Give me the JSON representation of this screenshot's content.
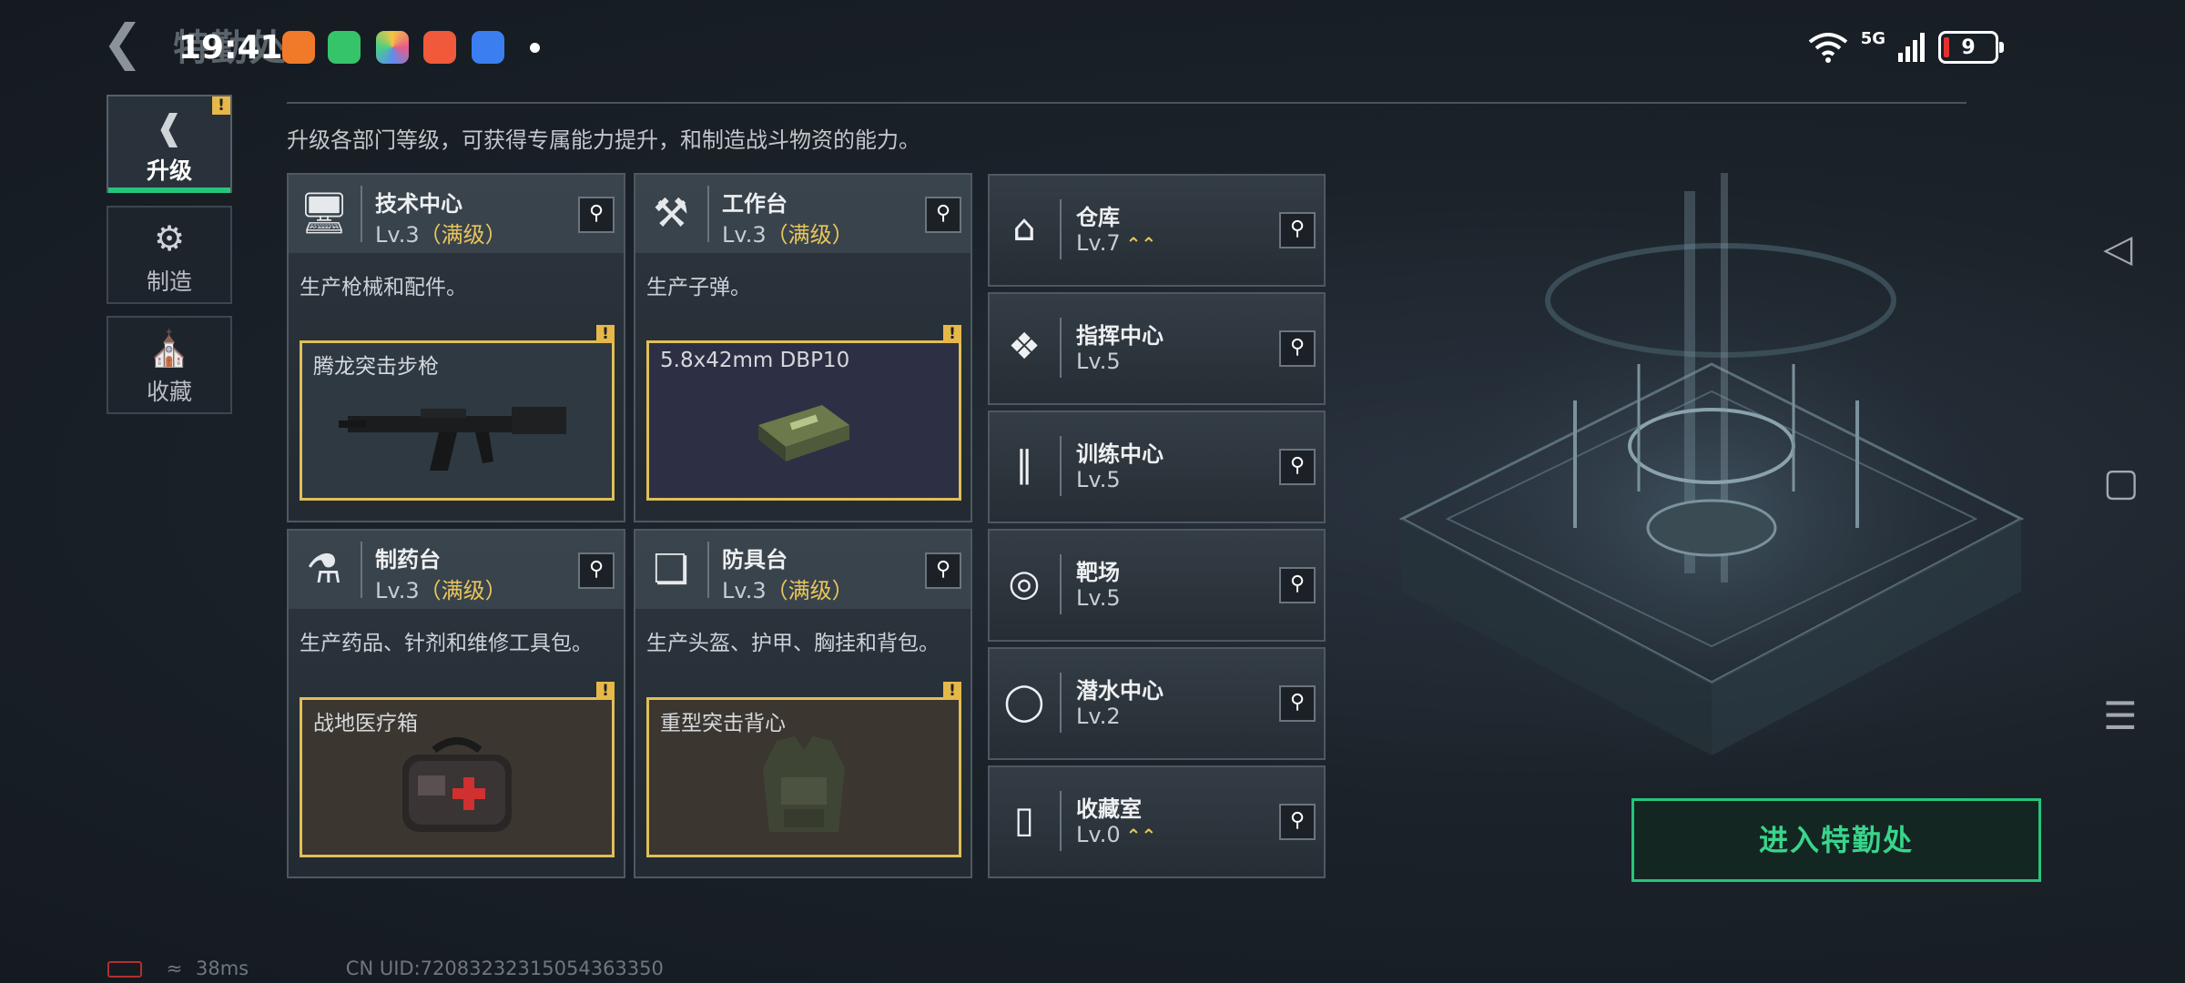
{
  "status_bar": {
    "time": "19:41",
    "ghost_title": "特勤处",
    "network": "5G",
    "battery": "9"
  },
  "side_tabs": [
    {
      "label": "升级",
      "icon": "upgrade-icon"
    },
    {
      "label": "制造",
      "icon": "gears-icon"
    },
    {
      "label": "收藏",
      "icon": "trophy-icon"
    }
  ],
  "intro": "升级各部门等级，可获得专属能力提升，和制造战斗物资的能力。",
  "cards": [
    {
      "name": "技术中心",
      "lv": "Lv.3",
      "max": "（满级）",
      "desc": "生产枪械和配件。",
      "item": "腾龙突击步枪"
    },
    {
      "name": "工作台",
      "lv": "Lv.3",
      "max": "（满级）",
      "desc": "生产子弹。",
      "item": "5.8x42mm DBP10"
    },
    {
      "name": "制药台",
      "lv": "Lv.3",
      "max": "（满级）",
      "desc": "生产药品、针剂和维修工具包。",
      "item": "战地医疗箱"
    },
    {
      "name": "防具台",
      "lv": "Lv.3",
      "max": "（满级）",
      "desc": "生产头盔、护甲、胸挂和背包。",
      "item": "重型突击背心"
    }
  ],
  "list_cards": [
    {
      "name": "仓库",
      "lv": "Lv.7",
      "upgradable": true
    },
    {
      "name": "指挥中心",
      "lv": "Lv.5",
      "upgradable": false
    },
    {
      "name": "训练中心",
      "lv": "Lv.5",
      "upgradable": false
    },
    {
      "name": "靶场",
      "lv": "Lv.5",
      "upgradable": false
    },
    {
      "name": "潜水中心",
      "lv": "Lv.2",
      "upgradable": false
    },
    {
      "name": "收藏室",
      "lv": "Lv.0",
      "upgradable": true
    }
  ],
  "enter_button": "进入特勤处",
  "footer": {
    "ping": "38ms",
    "uid": "CN UID:72083232315054363350"
  },
  "colors": {
    "accent": "#27c57a",
    "max_level": "#e9c65b",
    "badge": "#e6b84a"
  }
}
